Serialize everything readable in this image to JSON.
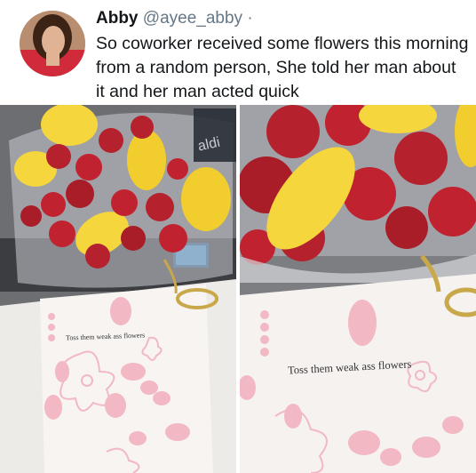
{
  "tweet": {
    "author_name": "Abby",
    "author_handle": "@ayee_abby",
    "separator": "·",
    "text": "So coworker received some flowers this morning from a random person, She told her man about it and her man acted quick"
  },
  "photos": [
    {
      "card_text": "Toss them weak ass flowers",
      "bag_label": "aldi"
    },
    {
      "card_text": "Toss them weak ass flowers"
    }
  ],
  "colors": {
    "text": "#14171a",
    "muted": "#657786",
    "card_pink": "#f2b8c4",
    "strawberry": "#c0232f",
    "pineapple": "#f5d63d"
  }
}
